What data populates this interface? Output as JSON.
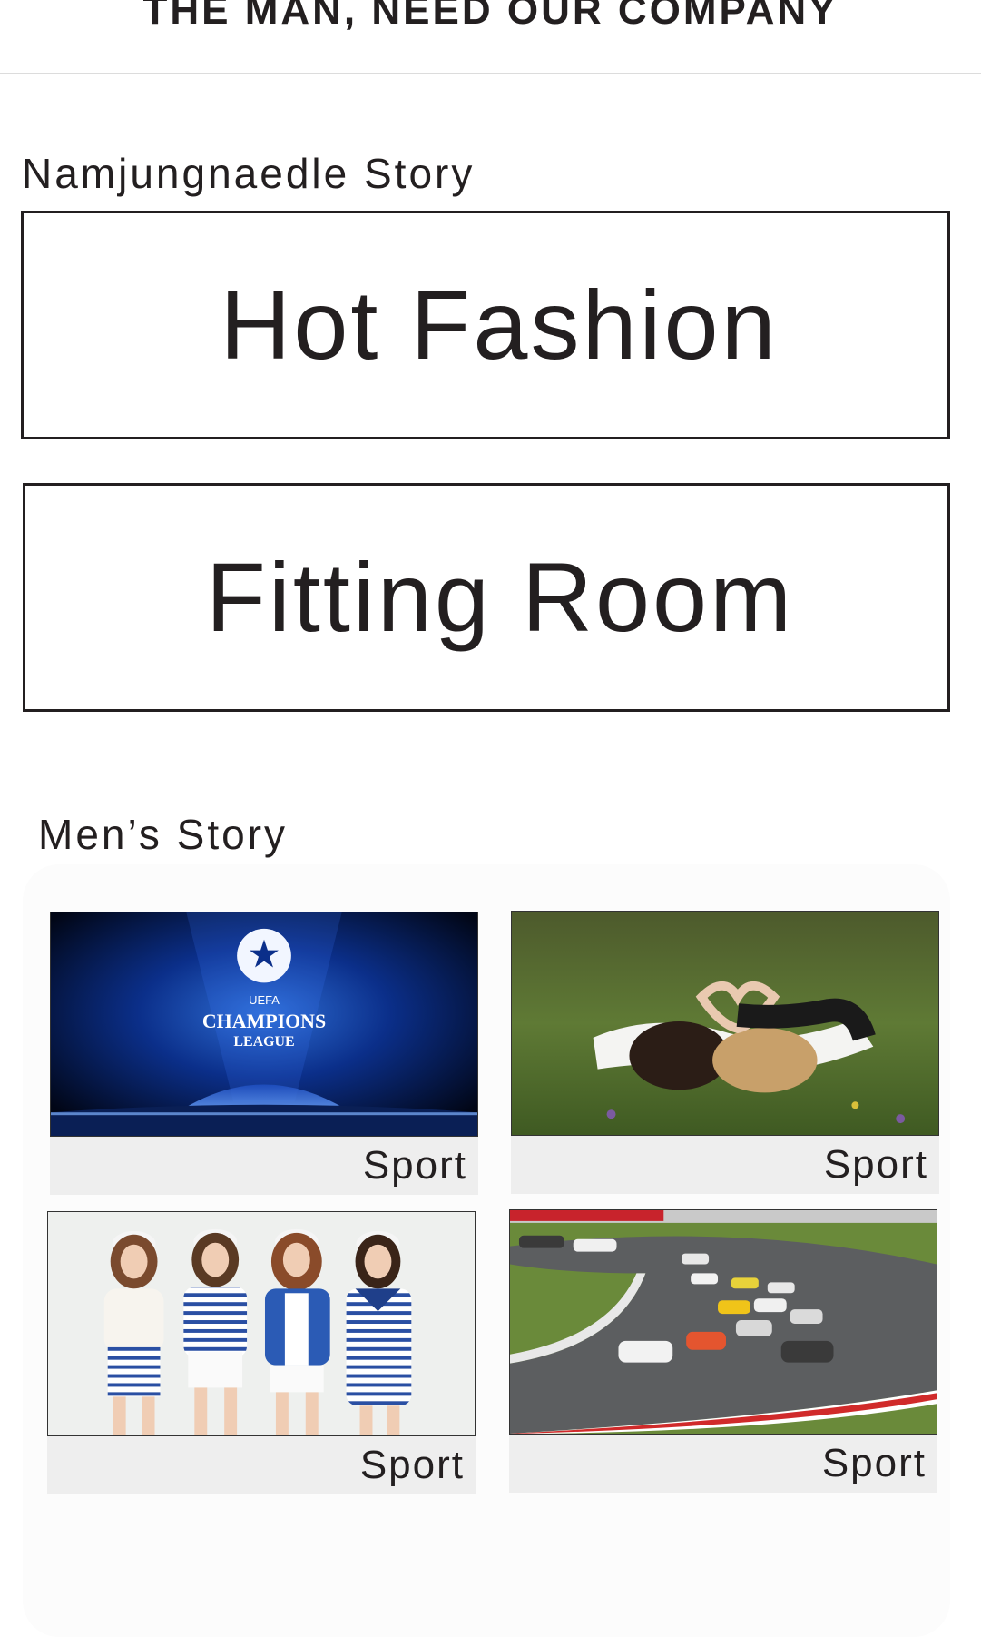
{
  "header": {
    "title": "THE MAN, NEED OUR COMPANY"
  },
  "sections": {
    "namjung": {
      "title": "Namjungnaedle Story",
      "menus": [
        {
          "label": "Hot Fashion"
        },
        {
          "label": "Fitting Room"
        }
      ]
    },
    "mens": {
      "title": "Men’s Story",
      "cards": [
        {
          "caption": "Sport",
          "image": "champions-league-logo",
          "logo_lines": [
            "UEFA",
            "CHAMPIONS",
            "LEAGUE"
          ]
        },
        {
          "caption": "Sport",
          "image": "couple-lying-on-grass-heart-hands"
        },
        {
          "caption": "Sport",
          "image": "four-girls-striped-outfits"
        },
        {
          "caption": "Sport",
          "image": "race-cars-on-track"
        }
      ]
    }
  },
  "colors": {
    "text": "#231f20",
    "caption_bg": "#eeeeee",
    "divider": "#dcdcdc"
  }
}
